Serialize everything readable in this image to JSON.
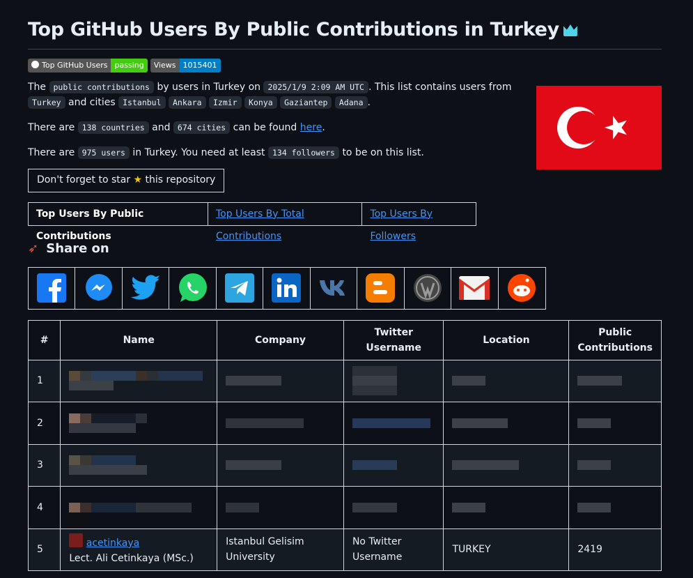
{
  "title": "Top GitHub Users By Public Contributions in Turkey",
  "badges": {
    "build_label": "Top GitHub Users",
    "build_status": "passing",
    "views_label": "Views",
    "views_value": "1015401"
  },
  "intro": {
    "p1_a": "The",
    "code_public": "public contributions",
    "p1_b": "by users in Turkey on",
    "code_date": "2025/1/9 2:09 AM UTC",
    "p1_c": ". This list contains users from",
    "code_turkey": "Turkey",
    "p1_d": "and cities",
    "cities": [
      "Istanbul",
      "Ankara",
      "Izmir",
      "Konya",
      "Gaziantep",
      "Adana"
    ],
    "p2_a": "There are",
    "code_countries": "138 countries",
    "p2_b": "and",
    "code_cities": "674 cities",
    "p2_c": "can be found",
    "link_here": "here",
    "p3_a": "There are",
    "code_users": "975 users",
    "p3_b": "in Turkey. You need at least",
    "code_followers": "134 followers",
    "p3_c": "to be on this list."
  },
  "star": {
    "before": "Don't forget to star",
    "after": "this repository"
  },
  "tabs": [
    {
      "label": "Top Users By Public Contributions"
    },
    {
      "label": "Top Users By Total Contributions"
    },
    {
      "label": "Top Users By Followers"
    }
  ],
  "share": {
    "heading": "Share on",
    "icons": [
      "facebook-icon",
      "messenger-icon",
      "twitter-icon",
      "whatsapp-icon",
      "telegram-icon",
      "linkedin-icon",
      "vk-icon",
      "blogger-icon",
      "wordpress-icon",
      "gmail-icon",
      "reddit-icon"
    ]
  },
  "table": {
    "headers": [
      "#",
      "Name",
      "Company",
      "Twitter Username",
      "Location",
      "Public Contributions"
    ],
    "rows": [
      {
        "rank": "1"
      },
      {
        "rank": "2"
      },
      {
        "rank": "3"
      },
      {
        "rank": "4"
      },
      {
        "rank": "5",
        "username": "acetinkaya",
        "name": "Lect. Ali Cetinkaya (MSc.)",
        "company": "Istanbul Gelisim University",
        "twitter": "No Twitter Username",
        "location": "TURKEY",
        "contributions": "2419"
      }
    ]
  },
  "colors": {
    "background": "#0d1117",
    "link": "#4493f8",
    "flag_red": "#e30a17"
  }
}
